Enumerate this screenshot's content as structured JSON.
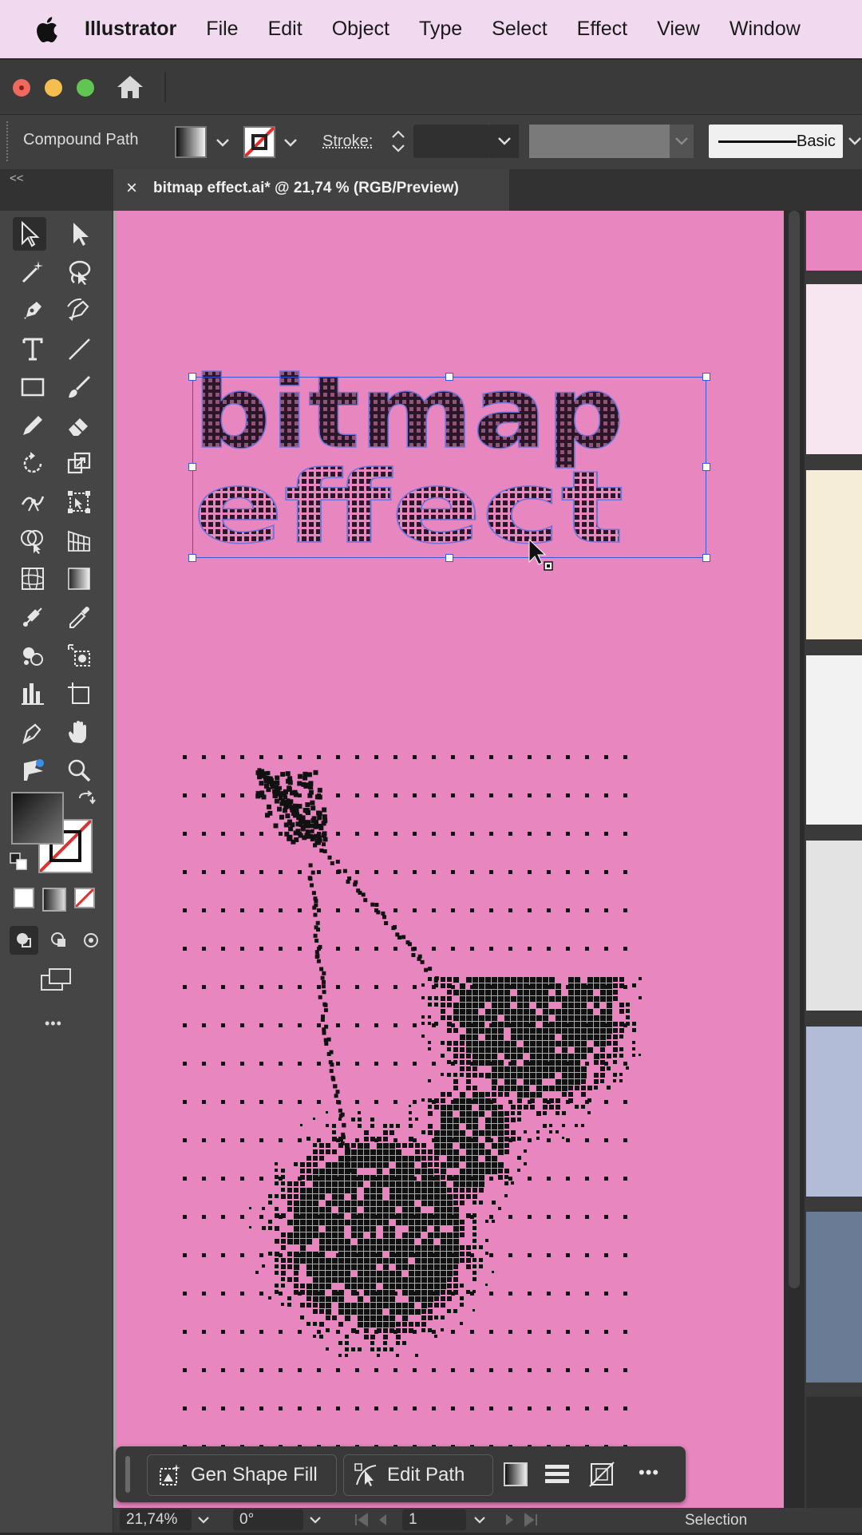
{
  "menubar": {
    "app_name": "Illustrator",
    "items": [
      "File",
      "Edit",
      "Object",
      "Type",
      "Select",
      "Effect",
      "View",
      "Window"
    ]
  },
  "controlbar": {
    "selection_type": "Compound Path",
    "stroke_label": "Stroke:",
    "brush_label": "Basic"
  },
  "document_tab": {
    "close_glyph": "×",
    "title": "bitmap effect.ai* @ 21,74 % (RGB/Preview)"
  },
  "toolbar": {
    "collapse_glyph": "<<",
    "more_glyph": "•••"
  },
  "artwork": {
    "line1": "bitmap",
    "line2": "effect"
  },
  "taskbar": {
    "gen_shape_fill_label": "Gen Shape Fill",
    "edit_path_label": "Edit Path",
    "more_glyph": "•••"
  },
  "statusbar": {
    "zoom": "21,74%",
    "rotation": "0°",
    "artboard_number": "1",
    "current_tool": "Selection"
  },
  "colors": {
    "artboard": "#e886c0",
    "menubar": "#f1d9ef",
    "selection": "#3c5ad8",
    "swatches": [
      "#e886c0",
      "#f7e6f0",
      "#f6edd8",
      "#f2f2f2",
      "#e3e3e3",
      "#b3bcd6",
      "#6a7b96",
      "#2f2f2f"
    ]
  }
}
